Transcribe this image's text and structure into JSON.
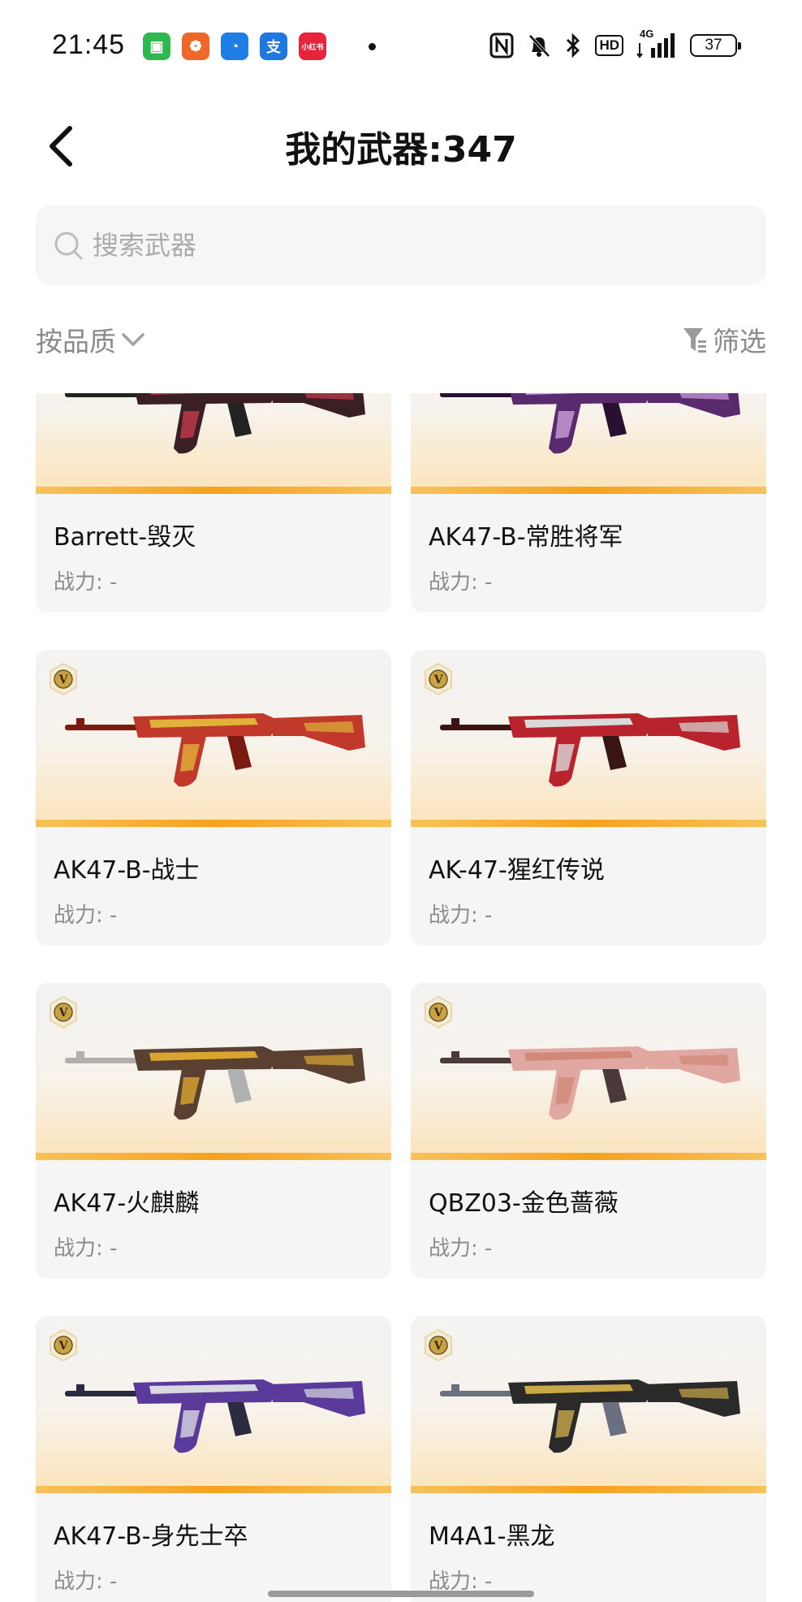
{
  "status": {
    "time": "21:45",
    "apps": [
      {
        "icon": "wechat-icon",
        "color": "#2fb84f",
        "glyph": "▣"
      },
      {
        "icon": "taobao-icon",
        "color": "#f0672a",
        "glyph": "❁"
      },
      {
        "icon": "android-icon",
        "color": "#1f7de6",
        "glyph": "◔"
      },
      {
        "icon": "alipay-icon",
        "color": "#1f78e0",
        "glyph": "支"
      },
      {
        "icon": "xiaohongshu-icon",
        "color": "#e8243c",
        "glyph": "小红书"
      }
    ],
    "network": "4G",
    "hd": "HD",
    "battery": "37"
  },
  "header": {
    "title": "我的武器:347"
  },
  "search": {
    "placeholder": "搜索武器"
  },
  "sortbar": {
    "sort_label": "按品质",
    "filter_label": "筛选"
  },
  "weapons": [
    {
      "name": "Barrett-毁灭",
      "power": "战力: -",
      "badge": false,
      "palette": {
        "body": "#3a1f25",
        "accent": "#c23a4a",
        "trim": "#222"
      }
    },
    {
      "name": "AK47-B-常胜将军",
      "power": "战力: -",
      "badge": false,
      "palette": {
        "body": "#5a2a6e",
        "accent": "#c9a0d8",
        "trim": "#2a1030"
      }
    },
    {
      "name": "AK47-B-战士",
      "power": "战力: -",
      "badge": true,
      "palette": {
        "body": "#c0392b",
        "accent": "#e0b23a",
        "trim": "#7a1a10"
      }
    },
    {
      "name": "AK-47-猩红传说",
      "power": "战力: -",
      "badge": true,
      "palette": {
        "body": "#b8232e",
        "accent": "#d9d9d9",
        "trim": "#3a1515"
      }
    },
    {
      "name": "AK47-火麒麟",
      "power": "战力: -",
      "badge": true,
      "palette": {
        "body": "#5a4030",
        "accent": "#d9a530",
        "trim": "#b0b0b0"
      }
    },
    {
      "name": "QBZ03-金色蔷薇",
      "power": "战力: -",
      "badge": true,
      "palette": {
        "body": "#e0a8a0",
        "accent": "#d08878",
        "trim": "#4a3a3a"
      }
    },
    {
      "name": "AK47-B-身先士卒",
      "power": "战力: -",
      "badge": true,
      "palette": {
        "body": "#5a3a9a",
        "accent": "#d8d8e0",
        "trim": "#2a2a40"
      }
    },
    {
      "name": "M4A1-黑龙",
      "power": "战力: -",
      "badge": true,
      "palette": {
        "body": "#2a2a2a",
        "accent": "#c9a84a",
        "trim": "#6a7080"
      }
    }
  ]
}
